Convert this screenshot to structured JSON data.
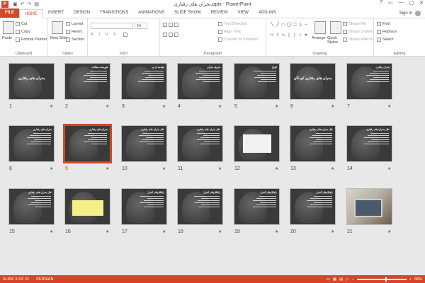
{
  "app": {
    "icon_label": "P",
    "title": "بحران های رفتاری.pptx - PowerPoint",
    "window_controls": [
      "?",
      "▭",
      "—",
      "▢",
      "✕"
    ]
  },
  "tabs": [
    "FILE",
    "HOME",
    "INSERT",
    "DESIGN",
    "TRANSITIONS",
    "ANIMATIONS",
    "SLIDE SHOW",
    "REVIEW",
    "VIEW",
    "ADD-INS"
  ],
  "signin": "Sign in",
  "ribbon": {
    "clipboard": {
      "label": "Clipboard",
      "paste": "Paste",
      "cut": "Cut",
      "copy": "Copy",
      "format_painter": "Format Painter"
    },
    "slides": {
      "label": "Slides",
      "new_slide": "New Slide",
      "layout": "Layout",
      "reset": "Reset",
      "section": "Section"
    },
    "font": {
      "label": "Font",
      "font_name": "",
      "font_size": "54"
    },
    "paragraph": {
      "label": "Paragraph",
      "text_direction": "Text Direction",
      "align_text": "Align Text",
      "convert_smartart": "Convert to SmartArt"
    },
    "drawing": {
      "label": "Drawing",
      "arrange": "Arrange",
      "quick_styles": "Quick Styles",
      "shape_fill": "Shape Fill",
      "shape_outline": "Shape Outline",
      "shape_effects": "Shape Effects"
    },
    "editing": {
      "label": "Editing",
      "find": "Find",
      "replace": "Replace",
      "select": "Select"
    }
  },
  "slides": [
    {
      "n": "1",
      "title": "",
      "big": "بحران های رفتاری",
      "kind": "title"
    },
    {
      "n": "2",
      "title": "فهرست مطالب",
      "kind": "text"
    },
    {
      "n": "3",
      "title": "مقدمه ای بر",
      "kind": "text"
    },
    {
      "n": "4",
      "title": "تعریف بحران",
      "kind": "text"
    },
    {
      "n": "5",
      "title": "انواع",
      "kind": "text"
    },
    {
      "n": "6",
      "title": "",
      "big": "بحران های رفتاری کودکان",
      "kind": "title"
    },
    {
      "n": "7",
      "title": "بحران رفتاری",
      "kind": "text"
    },
    {
      "n": "8",
      "title": "بحران های رفتاری",
      "kind": "text"
    },
    {
      "n": "9",
      "title": "بحران های رفتاری",
      "kind": "text"
    },
    {
      "n": "10",
      "title": "علل بحران های رفتاری",
      "kind": "text"
    },
    {
      "n": "11",
      "title": "علل بحران های رفتاری",
      "kind": "text"
    },
    {
      "n": "12",
      "title": "",
      "kind": "whitebox"
    },
    {
      "n": "13",
      "title": "علل بحران های رفتاری",
      "kind": "text"
    },
    {
      "n": "14",
      "title": "علل بحران های رفتاری",
      "kind": "text"
    },
    {
      "n": "15",
      "title": "علل بحران های رفتاری",
      "kind": "text"
    },
    {
      "n": "16",
      "title": "",
      "kind": "yellowbox"
    },
    {
      "n": "17",
      "title": "راهکارهای کنترل",
      "kind": "text"
    },
    {
      "n": "18",
      "title": "راهکارهای کنترل",
      "kind": "text"
    },
    {
      "n": "19",
      "title": "راهکارهای کنترل",
      "kind": "text"
    },
    {
      "n": "20",
      "title": "راهکارهای کنترل",
      "kind": "text"
    },
    {
      "n": "21",
      "title": "",
      "kind": "photo"
    }
  ],
  "selected_slide": "9",
  "status": {
    "slide_info": "SLIDE 9 OF 21",
    "language": "PERSIAN",
    "zoom": "68%"
  }
}
